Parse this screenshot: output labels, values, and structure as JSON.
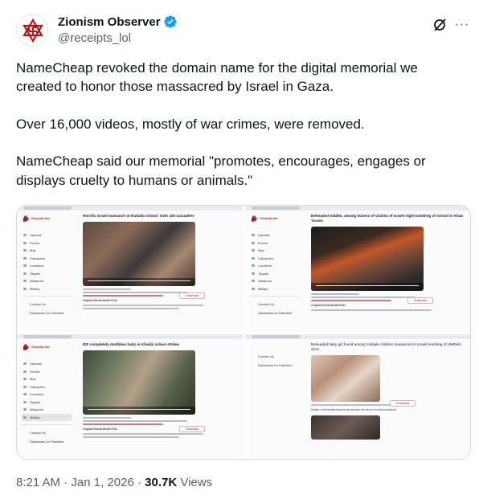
{
  "account": {
    "display_name": "Zionism Observer",
    "handle": "@receipts_lol",
    "verified": true,
    "avatar_icon": "star-of-david-swastika-logo-icon"
  },
  "actions": {
    "grok_icon": "grok-icon",
    "more_icon": "more-horizontal-icon",
    "more_label": "···"
  },
  "tweet": {
    "paragraphs": [
      "NameCheap revoked the domain name for the digital memorial we created to honor those massacred by Israel in Gaza.",
      "Over 16,000 videos, mostly of war crimes, were removed.",
      "NameCheap said our memorial \"promotes, encourages, engages or displays cruelty to humans or animals.\""
    ]
  },
  "media": {
    "screenshots": [
      {
        "title": "Horrific Israeli massacre at Rufaida school: Over 100 casualties",
        "sidebar_active": "",
        "download_label": "Download",
        "meta_heading": "Original Social Media Post"
      },
      {
        "title": "Beheaded toddler, among dozens of victims of Israeli night bombing of school in Khan Younis",
        "sidebar_active": "",
        "download_label": "Download",
        "meta_heading": "Original Social Media Post"
      },
      {
        "title": "IDF completely mutilates baby in Khadiji school strikes",
        "sidebar_active": "Military",
        "download_label": "Download",
        "meta_heading": "Original Social Media Post"
      },
      {
        "title": "Beheaded baby girl found among multiple children massacred in Israeli bombing of UNRWA clinic",
        "sidebar_active": "",
        "download_label": "Download",
        "meta_heading": "Mother of beheaded baby Amal recounts the horror of Israeli massacre"
      }
    ],
    "sidebar": {
      "brand": "Genocide.live",
      "items": [
        "Uploads",
        "Events",
        "Map",
        "Categories",
        "Locations",
        "Targets",
        "Weapons",
        "Military"
      ],
      "external": [
        "Contact Us",
        "Databases for Palestine"
      ]
    }
  },
  "footer": {
    "time": "8:21 AM",
    "separator": "·",
    "date": "Jan 1, 2026",
    "views_count": "30.7K",
    "views_label": "Views"
  },
  "colors": {
    "text": "#0f1419",
    "secondary": "#536471",
    "verified_blue": "#1d9bf0",
    "border": "#cfd9de",
    "memorial_red": "#a01b1b"
  }
}
